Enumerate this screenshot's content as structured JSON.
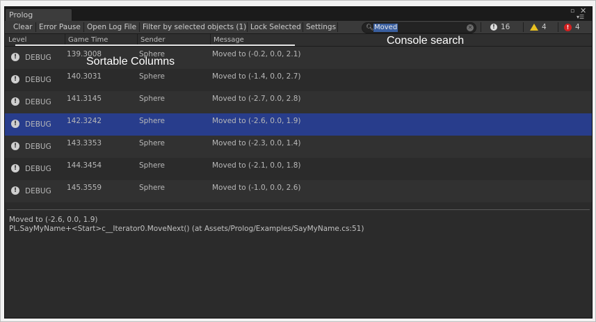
{
  "window": {
    "tab_title": "Prolog"
  },
  "toolbar": {
    "clear_label": "Clear",
    "error_pause_label": "Error Pause",
    "open_log_label": "Open Log File",
    "filter_label": "Filter by selected objects (1)",
    "lock_label": "Lock Selected",
    "settings_label": "Settings",
    "search_value": "Moved",
    "info_count": "16",
    "warning_count": "4",
    "error_count": "4"
  },
  "columns": [
    "Level",
    "Game Time",
    "Sender",
    "Message"
  ],
  "rows": [
    {
      "level": "DEBUG",
      "time": "139.3008",
      "sender": "Sphere",
      "message": "Moved to (-0.2, 0.0, 2.1)"
    },
    {
      "level": "DEBUG",
      "time": "140.3031",
      "sender": "Sphere",
      "message": "Moved to (-1.4, 0.0, 2.7)"
    },
    {
      "level": "DEBUG",
      "time": "141.3145",
      "sender": "Sphere",
      "message": "Moved to (-2.7, 0.0, 2.8)"
    },
    {
      "level": "DEBUG",
      "time": "142.3242",
      "sender": "Sphere",
      "message": "Moved to (-2.6, 0.0, 1.9)"
    },
    {
      "level": "DEBUG",
      "time": "143.3353",
      "sender": "Sphere",
      "message": "Moved to (-2.3, 0.0, 1.4)"
    },
    {
      "level": "DEBUG",
      "time": "144.3454",
      "sender": "Sphere",
      "message": "Moved to (-2.1, 0.0, 1.8)"
    },
    {
      "level": "DEBUG",
      "time": "145.3559",
      "sender": "Sphere",
      "message": "Moved to (-1.0, 0.0, 2.6)"
    }
  ],
  "selected_row": 3,
  "detail": {
    "line1": "Moved to (-2.6, 0.0, 1.9)",
    "line2": "PL.SayMyName+<Start>c__Iterator0.MoveNext() (at Assets/Prolog/Examples/SayMyName.cs:51)"
  },
  "annotations": {
    "columns_callout": "Sortable Columns",
    "search_callout": "Console search"
  },
  "colors": {
    "selected_row": "#283d8c",
    "background": "#2b2b2b",
    "warning": "#e8c020",
    "error": "#d42020"
  }
}
